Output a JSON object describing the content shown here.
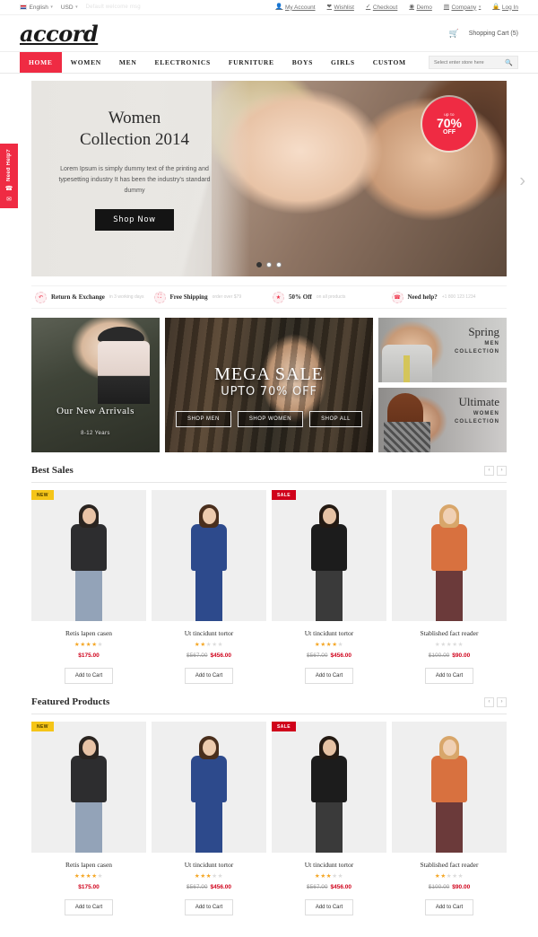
{
  "topbar": {
    "language": "English",
    "currency": "USD",
    "ghost_note": "Default welcome msg",
    "links": [
      {
        "label": "My Account",
        "icon": "user-icon"
      },
      {
        "label": "Wishlist",
        "icon": "heart-icon"
      },
      {
        "label": "Checkout",
        "icon": "check-icon"
      },
      {
        "label": "Demo",
        "icon": "eye-icon"
      },
      {
        "label": "Company",
        "icon": "building-icon"
      },
      {
        "label": "Log In",
        "icon": "lock-icon"
      }
    ]
  },
  "header": {
    "logo": "accord",
    "cart_label": "Shopping Cart (5)"
  },
  "nav": {
    "items": [
      {
        "label": "HOME",
        "active": true
      },
      {
        "label": "WOMEN",
        "active": false
      },
      {
        "label": "MEN",
        "active": false
      },
      {
        "label": "ELECTRONICS",
        "active": false
      },
      {
        "label": "FURNITURE",
        "active": false
      },
      {
        "label": "BOYS",
        "active": false
      },
      {
        "label": "GIRLS",
        "active": false
      },
      {
        "label": "CUSTOM",
        "active": false
      }
    ],
    "search_placeholder": "Select enter store here"
  },
  "side_tab": {
    "label": "Need Help?",
    "phone_icon": "phone-icon",
    "mail_icon": "envelope-icon"
  },
  "hero": {
    "title_line1": "Women",
    "title_line2": "Collection 2014",
    "description": "Lorem Ipsum is simply dummy text of the printing and typesetting industry It has been the industry's standard dummy",
    "button": "Shop Now",
    "badge_upto": "up to",
    "badge_percent": "70%",
    "badge_off": "OFF",
    "slides": 3,
    "active_slide": 1
  },
  "services": [
    {
      "title": "Return & Exchange",
      "note": "in 3 working days",
      "icon": "return-arrow-icon"
    },
    {
      "title": "Free Shipping",
      "note": "order over $79",
      "icon": "truck-icon"
    },
    {
      "title": "50% Off",
      "note": "on all products",
      "icon": "star-icon"
    },
    {
      "title": "Need help?",
      "note": "+1 800 123 1234",
      "icon": "phone-icon"
    }
  ],
  "promos": {
    "arrivals": {
      "title": "Our New Arrivals",
      "subtitle": "8-12 Years"
    },
    "mega": {
      "title": "MEGA SALE",
      "subtitle": "UPTO 70% OFF",
      "buttons": [
        "SHOP MEN",
        "SHOP WOMEN",
        "SHOP ALL"
      ]
    },
    "spring": {
      "title": "Spring",
      "line1": "MEN",
      "line2": "COLLECTION"
    },
    "ultimate": {
      "title": "Ultimate",
      "line1": "WOMEN",
      "line2": "COLLECTION"
    }
  },
  "sections": [
    {
      "title": "Best Sales",
      "prev": "‹",
      "next": "›",
      "products": [
        {
          "name": "Retis lapen casen",
          "badge": "NEW",
          "badge_type": "new",
          "rating": 4,
          "old_price": "",
          "price": "$175.00",
          "button": "Add to Cart",
          "colors": {
            "hair": "#2a2420",
            "skin": "#e8c3a6",
            "top": "#2d2d2f",
            "bottom": "#93a3b8",
            "bg": "#efefef"
          }
        },
        {
          "name": "Ut tincidunt tortor",
          "badge": "",
          "badge_type": "",
          "rating": 2,
          "old_price": "$567.00",
          "price": "$456.00",
          "button": "Add to Cart",
          "colors": {
            "hair": "#4a2f1d",
            "skin": "#edcbae",
            "top": "#2d4a8c",
            "bottom": "#2d4a8c",
            "bg": "#efefef"
          }
        },
        {
          "name": "Ut tincidunt tortor",
          "badge": "SALE",
          "badge_type": "sale",
          "rating": 4,
          "old_price": "$567.00",
          "price": "$456.00",
          "button": "Add to Cart",
          "colors": {
            "hair": "#241a13",
            "skin": "#e6c2a4",
            "top": "#1c1c1c",
            "bottom": "#3a3a3a",
            "bg": "#efefef"
          }
        },
        {
          "name": "Stablished fact reader",
          "badge": "",
          "badge_type": "",
          "rating": 0,
          "old_price": "$100.00",
          "price": "$90.00",
          "button": "Add to Cart",
          "colors": {
            "hair": "#d8a66a",
            "skin": "#f0d0b4",
            "top": "#d8713f",
            "bottom": "#6b3a3a",
            "bg": "#efefef"
          }
        }
      ]
    },
    {
      "title": "Featured Products",
      "prev": "‹",
      "next": "›",
      "products": [
        {
          "name": "Retis lapen casen",
          "badge": "NEW",
          "badge_type": "new",
          "rating": 4,
          "old_price": "",
          "price": "$175.00",
          "button": "Add to Cart",
          "colors": {
            "hair": "#2a2420",
            "skin": "#e8c3a6",
            "top": "#2d2d2f",
            "bottom": "#93a3b8",
            "bg": "#efefef"
          }
        },
        {
          "name": "Ut tincidunt tortor",
          "badge": "",
          "badge_type": "",
          "rating": 3,
          "old_price": "$567.00",
          "price": "$456.00",
          "button": "Add to Cart",
          "colors": {
            "hair": "#4a2f1d",
            "skin": "#edcbae",
            "top": "#2d4a8c",
            "bottom": "#2d4a8c",
            "bg": "#efefef"
          }
        },
        {
          "name": "Ut tincidunt tortor",
          "badge": "SALE",
          "badge_type": "sale",
          "rating": 3,
          "old_price": "$567.00",
          "price": "$456.00",
          "button": "Add to Cart",
          "colors": {
            "hair": "#241a13",
            "skin": "#e6c2a4",
            "top": "#1c1c1c",
            "bottom": "#3a3a3a",
            "bg": "#efefef"
          }
        },
        {
          "name": "Stablished fact reader",
          "badge": "",
          "badge_type": "",
          "rating": 2,
          "old_price": "$100.00",
          "price": "$90.00",
          "button": "Add to Cart",
          "colors": {
            "hair": "#d8a66a",
            "skin": "#f0d0b4",
            "top": "#d8713f",
            "bottom": "#6b3a3a",
            "bg": "#efefef"
          }
        }
      ]
    }
  ],
  "theme": {
    "accent": "#ef2b43",
    "sale_red": "#d0021b",
    "new_yellow": "#f5c518",
    "star_gold": "#f5a623"
  }
}
